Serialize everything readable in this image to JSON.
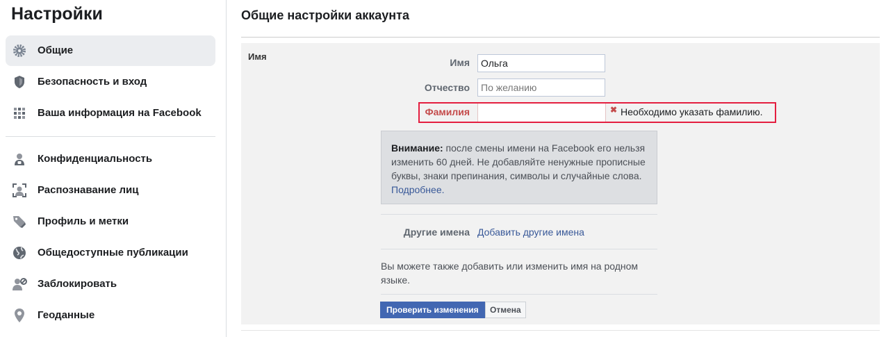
{
  "sidebar": {
    "title": "Настройки",
    "items": [
      {
        "label": "Общие",
        "icon": "gear-icon"
      },
      {
        "label": "Безопасность и вход",
        "icon": "shield-icon"
      },
      {
        "label": "Ваша информация на Facebook",
        "icon": "grid-icon"
      },
      {
        "label": "Конфиденциальность",
        "icon": "lock-icon"
      },
      {
        "label": "Распознавание лиц",
        "icon": "face-recognition-icon"
      },
      {
        "label": "Профиль и метки",
        "icon": "tag-icon"
      },
      {
        "label": "Общедоступные публикации",
        "icon": "globe-icon"
      },
      {
        "label": "Заблокировать",
        "icon": "block-user-icon"
      },
      {
        "label": "Геоданные",
        "icon": "location-pin-icon"
      }
    ],
    "active_index": 0
  },
  "main": {
    "title": "Общие настройки аккаунта",
    "section_label": "Имя",
    "fields": {
      "first_name": {
        "label": "Имя",
        "value": "Ольга"
      },
      "middle_name": {
        "label": "Отчество",
        "value": "",
        "placeholder": "По желанию"
      },
      "last_name": {
        "label": "Фамилия",
        "value": "",
        "error": "Необходимо указать фамилию."
      }
    },
    "notice": {
      "bold": "Внимание:",
      "text": " после смены имени на Facebook его нельзя изменить 60 дней. Не добавляйте ненужные прописные буквы, знаки препинания, символы и случайные слова. ",
      "link": "Подробнее."
    },
    "other_names": {
      "label": "Другие имена",
      "link": "Добавить другие имена"
    },
    "native_text": "Вы можете также добавить или изменить имя на родном языке.",
    "buttons": {
      "review": "Проверить изменения",
      "cancel": "Отмена"
    }
  },
  "colors": {
    "accent": "#4267b2",
    "link": "#385898",
    "error": "#e41e3f"
  }
}
